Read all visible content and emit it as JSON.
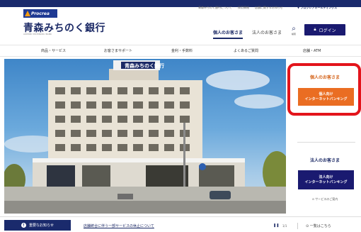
{
  "brand": {
    "badge": "Procrea",
    "name": "青森みちのく銀行",
    "tagline": "AOMORI MICHINOKU BANK"
  },
  "header": {
    "util_links": [
      "青森みちのく銀行について",
      "採用情報",
      "店舗に関するお知らせ"
    ],
    "group_link": "プロクレアホールディングス",
    "segments": {
      "personal": "個人のお客さま",
      "corporate": "法人のお客さま"
    },
    "search_label": "検索",
    "login_label": "ログイン"
  },
  "nav": {
    "items": [
      "商品・サービス",
      "お客さまサポート",
      "金利・手数料",
      "よくあるご質問",
      "店舗・ATM"
    ]
  },
  "side": {
    "personal_title": "個人のお客さま",
    "personal_button": [
      "個人向け",
      "インターネットバンキング"
    ],
    "corporate_title": "法人のお客さま",
    "corporate_button": [
      "法人向け",
      "インターネットバンキング"
    ],
    "service_link": "サービスのご案内"
  },
  "hero": {
    "sign": "青森みちのく銀行"
  },
  "notice": {
    "label": "重要なお知らせ",
    "text": "店舗統合に伴う一部サービスの休止について",
    "pager": "1/1",
    "list_link": "一覧はこちら"
  },
  "colors": {
    "navy": "#1a2a6c",
    "orange": "#ea6d22",
    "highlight_red": "#e3141b"
  }
}
